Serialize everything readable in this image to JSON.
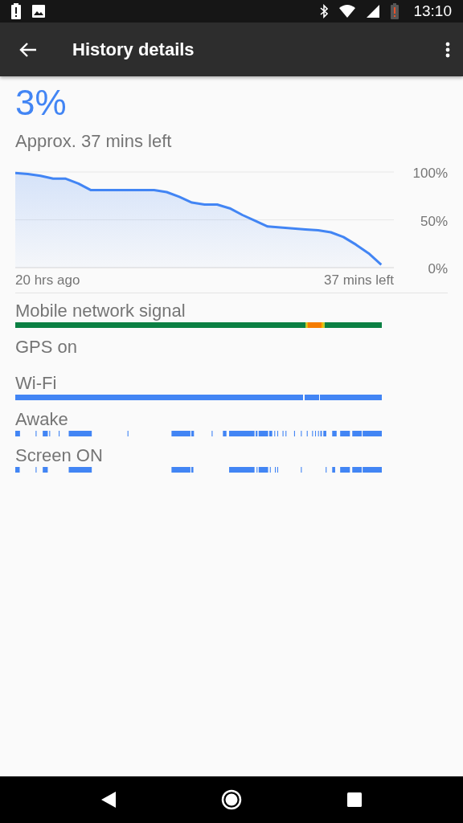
{
  "status_bar": {
    "time": "13:10"
  },
  "toolbar": {
    "title": "History details"
  },
  "battery": {
    "percent": "3%",
    "estimate": "Approx. 37 mins left"
  },
  "chart_data": {
    "type": "area",
    "categories": [
      null,
      null,
      null,
      null,
      null,
      null,
      null,
      null,
      null,
      null,
      null,
      null,
      null,
      null,
      null,
      null,
      null,
      null,
      null,
      null,
      null,
      null,
      null,
      null,
      null,
      null,
      null,
      null,
      null,
      null,
      null
    ],
    "series": [
      {
        "color": "#4285f4",
        "values": [
          99,
          98,
          96,
          93,
          93,
          88,
          81,
          81,
          81,
          81,
          81,
          81,
          79,
          74,
          68,
          66,
          66,
          62,
          55,
          49,
          43,
          42,
          41,
          40,
          39,
          37,
          32,
          24,
          15,
          3,
          null
        ]
      }
    ],
    "ylim": [
      0,
      100
    ],
    "yticks": [
      {
        "value": 0,
        "label": "0%"
      },
      {
        "value": 50,
        "label": "50%"
      },
      {
        "value": 100,
        "label": "100%"
      }
    ]
  },
  "time_axis": {
    "start": "20 hrs ago",
    "end": "37 mins left"
  },
  "timelines": [
    {
      "label": "Mobile network signal",
      "kind": "signal"
    },
    {
      "label": "GPS on",
      "kind": "none"
    },
    {
      "label": "Wi-Fi",
      "kind": "wifi"
    },
    {
      "label": "Awake",
      "kind": "awake"
    },
    {
      "label": "Screen ON",
      "kind": "screen"
    }
  ]
}
